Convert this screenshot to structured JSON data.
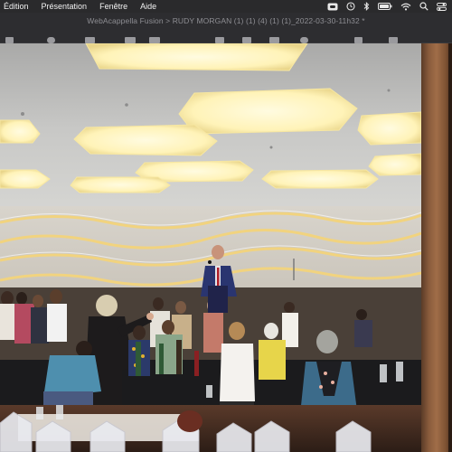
{
  "menubar": {
    "items": [
      "Édition",
      "Présentation",
      "Fenêtre",
      "Aide"
    ]
  },
  "status_icons": [
    "creative-cloud-icon",
    "time-machine-icon",
    "bluetooth-icon",
    "battery-icon",
    "wifi-icon",
    "search-icon",
    "control-center-icon"
  ],
  "window": {
    "title": "WebAcappella Fusion > RUDY MORGAN (1) (1) (4) (1) (1)_2022-03-30-11h32 *"
  },
  "colors": {
    "menubar_bg": "#2a2a2c",
    "titlebar_bg": "#2d2d30",
    "ceiling": "#c9c9c7",
    "panel_glow": "#fff2b0",
    "wall_wave_light": "#f5d98a"
  }
}
